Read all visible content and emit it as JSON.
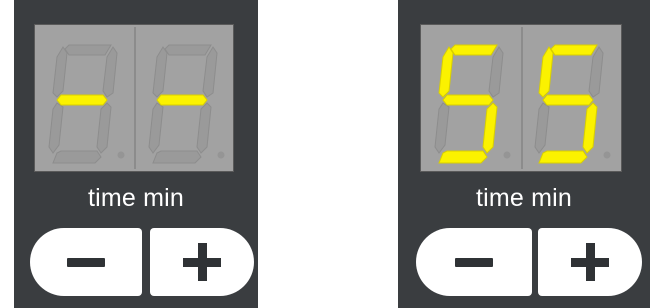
{
  "widgets": [
    {
      "display": {
        "digits": [
          "-",
          "-"
        ]
      },
      "label": "time min",
      "minus_button": {
        "icon": "minus-icon"
      },
      "plus_button": {
        "icon": "plus-icon"
      }
    },
    {
      "display": {
        "digits": [
          "5",
          "5"
        ]
      },
      "label": "time min",
      "minus_button": {
        "icon": "minus-icon"
      },
      "plus_button": {
        "icon": "plus-icon"
      }
    }
  ],
  "colors": {
    "panel": "#3a3d40",
    "display_bg": "#a2a2a2",
    "segment_on": "#fbf200",
    "segment_off": "#9a9a9a",
    "label": "#ffffff",
    "button": "#ffffff",
    "button_glyph": "#2f3235"
  }
}
